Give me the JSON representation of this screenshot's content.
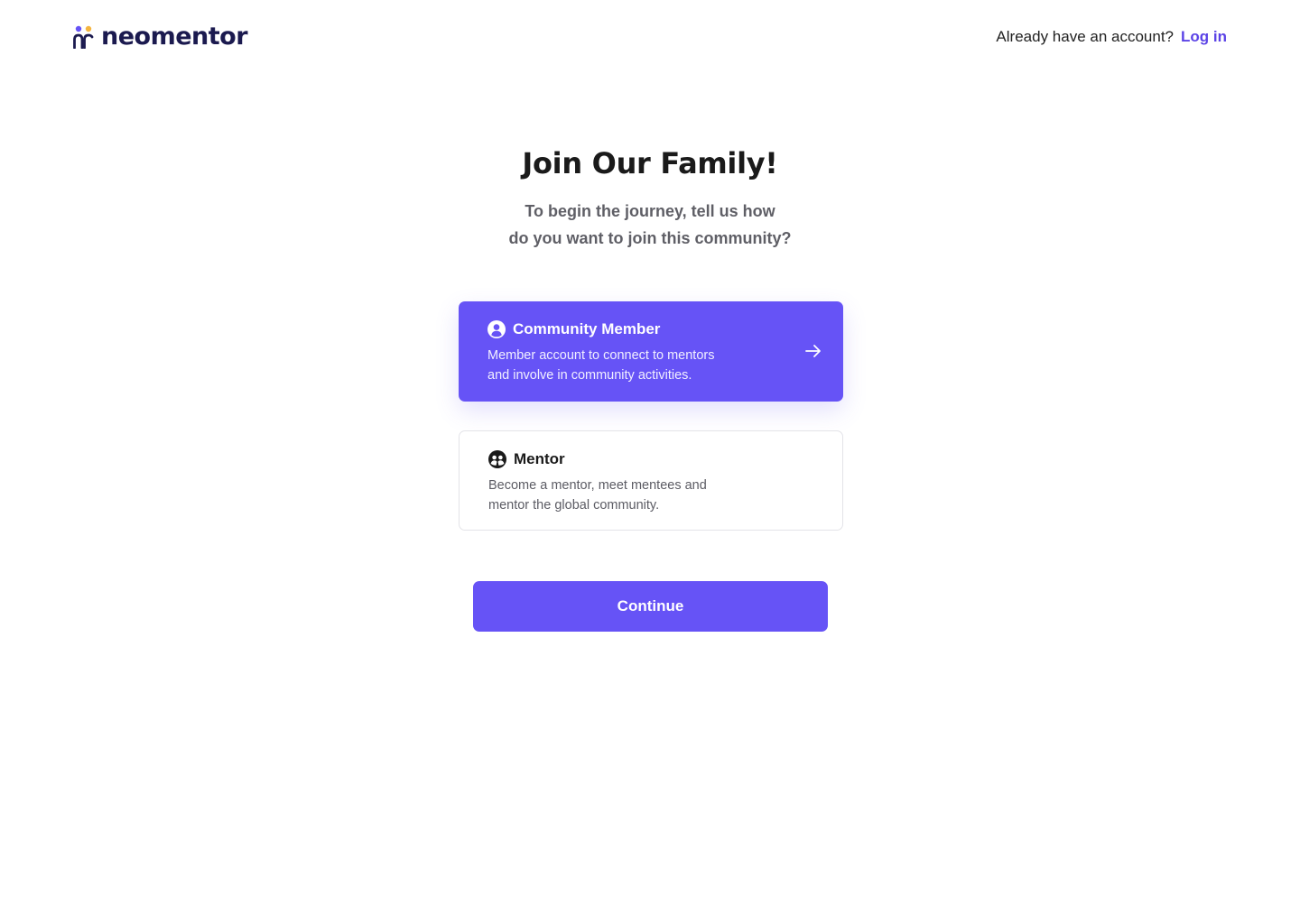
{
  "header": {
    "logo_text": "neomentor",
    "logo_icon": "neomentor-mark-icon",
    "account_prompt": "Already have an account?",
    "login_label": "Log in"
  },
  "hero": {
    "title": "Join Our Family!",
    "subtitle_line1": "To begin the journey, tell us how",
    "subtitle_line2": "do you want to join this community?"
  },
  "options": [
    {
      "title": "Community Member",
      "desc_line1": "Member account to connect to mentors",
      "desc_line2": "and involve in community activities.",
      "icon": "user-circle-icon",
      "selected": true
    },
    {
      "title": "Mentor",
      "desc_line1": "Become a mentor, meet mentees and",
      "desc_line2": "mentor the global community.",
      "icon": "group-circle-icon",
      "selected": false
    }
  ],
  "continue_label": "Continue",
  "colors": {
    "accent": "#6653f6",
    "link": "#5b43e6",
    "logo_text": "#1b1a4f",
    "logo_dot_purple": "#6653f6",
    "logo_dot_orange": "#f5b540"
  }
}
